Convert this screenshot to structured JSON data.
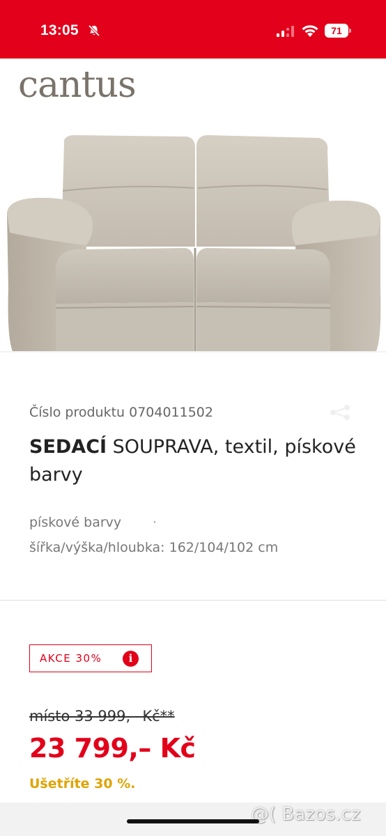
{
  "status_bar": {
    "time": "13:05",
    "battery": "71",
    "icons": [
      "bell-slash-icon",
      "cellular-signal-icon",
      "wifi-icon",
      "battery-icon"
    ],
    "background_color": "#e2001a"
  },
  "brand": {
    "logo_text": "cantus"
  },
  "product": {
    "number_line": "Číslo produktu 0704011502",
    "title_bold": "SEDACÍ",
    "title_rest": " SOUPRAVA, textil, pískové barvy",
    "attr_color": "pískové barvy",
    "attr_separator": "·",
    "attr_dimensions": "šířka/výška/hloubka: 162/104/102 cm"
  },
  "pricing": {
    "promo_label": "AKCE 30%",
    "info_icon_glyph": "i",
    "old_price": "místo 33 999,– Kč**",
    "new_price": "23 799,– Kč",
    "savings": "Ušetříte 30 %.",
    "accent_color": "#e2001a",
    "savings_color": "#e0a300"
  },
  "watermark": {
    "text": "@( Bazos.cz"
  }
}
